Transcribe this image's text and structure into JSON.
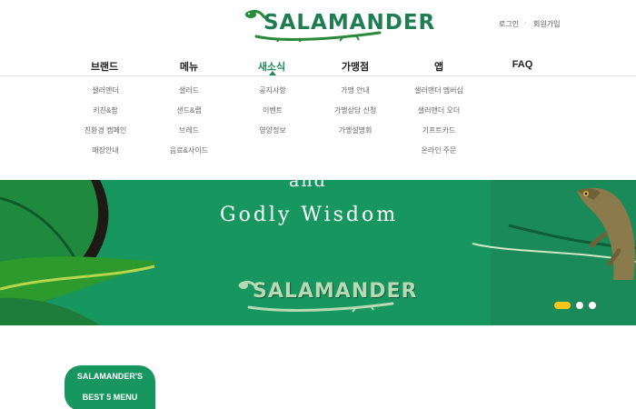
{
  "header": {
    "logo_text": "SALAMANDER",
    "util": {
      "login": "로그인",
      "separator": "·",
      "signup": "회원가입"
    }
  },
  "gnb": {
    "items": [
      {
        "label": "브랜드"
      },
      {
        "label": "메뉴"
      },
      {
        "label": "새소식"
      },
      {
        "label": "가맹점"
      },
      {
        "label": "앱"
      },
      {
        "label": "FAQ"
      }
    ],
    "active": "새소식"
  },
  "dropdown": {
    "columns": [
      [
        "샐러맨더",
        "키친&팜",
        "친환경 캠페인",
        "매장안내"
      ],
      [
        "샐러드",
        "샌드&랩",
        "브레드",
        "음료&사이드"
      ],
      [
        "공지사항",
        "이벤트",
        "영양정보"
      ],
      [
        "가맹 안내",
        "가맹상담 신청",
        "가맹설명회"
      ],
      [
        "샐러맨더 멤버십",
        "샐러맨더 오더",
        "기프트카드",
        "온라인 주문"
      ]
    ]
  },
  "banner": {
    "text_top": "and",
    "text": "Godly Wisdom",
    "logo_text": "SALAMANDER",
    "slide_count": 3,
    "active_slide": 1
  },
  "best_menu": {
    "line1": "SALAMANDER'S",
    "line2": "BEST 5 MENU"
  },
  "colors": {
    "brand_green": "#17965f",
    "logo_green": "#1f7d52",
    "dot_active": "#f5c518"
  }
}
